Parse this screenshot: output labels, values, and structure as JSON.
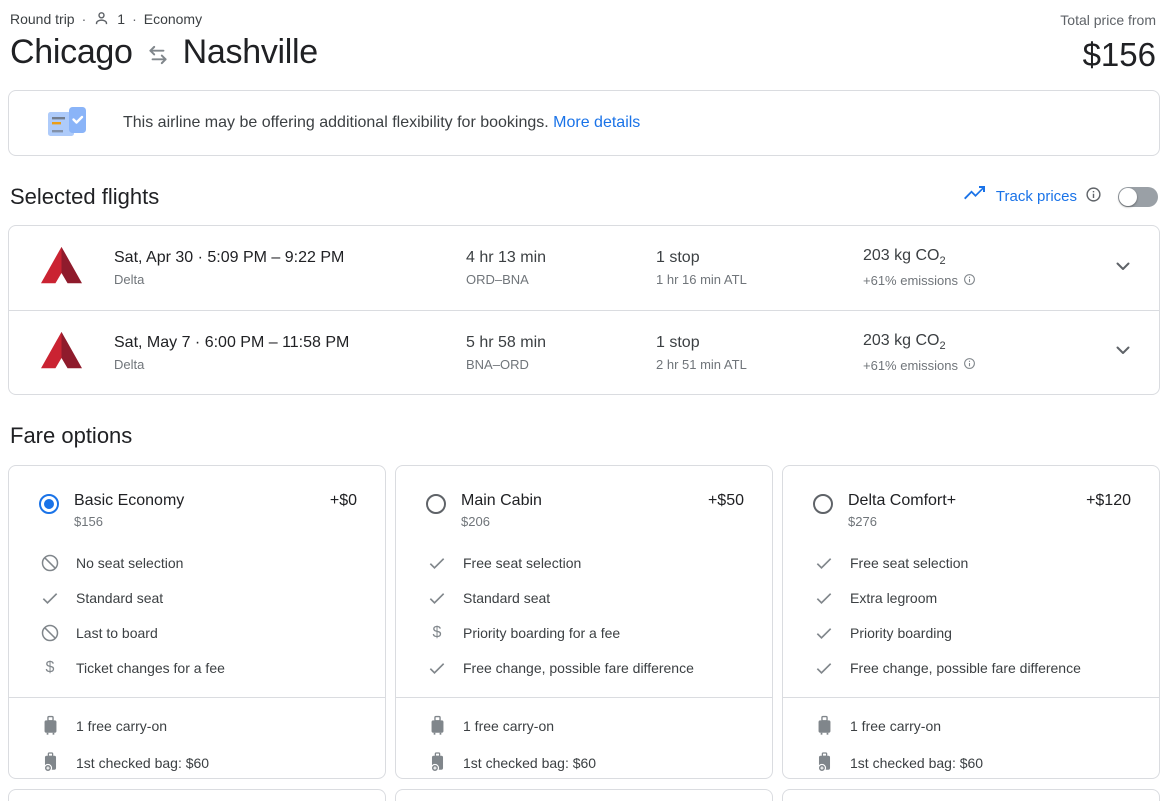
{
  "colors": {
    "accent_blue": "#1a73e8",
    "border_gray": "#dadce0",
    "text_dark": "#202124",
    "text_gray": "#5f6368",
    "delta_red_light": "#ca2332",
    "delta_red_dark": "#8f1b2c"
  },
  "header": {
    "trip_type": "Round trip",
    "separator": "·",
    "passengers": "1",
    "cabin": "Economy",
    "origin": "Chicago",
    "destination": "Nashville",
    "total_price_label": "Total price from",
    "total_price": "$156"
  },
  "banner": {
    "message": "This airline may be offering additional flexibility for bookings.",
    "link_label": "More details"
  },
  "selected_flights": {
    "title": "Selected flights",
    "track_prices_label": "Track prices",
    "toggle_state": "off",
    "flights": [
      {
        "date_times": "Sat, Apr 30  ·  5:09 PM – 9:22 PM",
        "airline": "Delta",
        "duration": "4 hr 13 min",
        "route": "ORD–BNA",
        "stops": "1 stop",
        "layover": "1 hr 16 min ATL",
        "emissions": "203 kg CO",
        "emissions_sub": "2",
        "emissions_delta": "+61% emissions"
      },
      {
        "date_times": "Sat, May 7  ·  6:00 PM – 11:58 PM",
        "airline": "Delta",
        "duration": "5 hr 58 min",
        "route": "BNA–ORD",
        "stops": "1 stop",
        "layover": "2 hr 51 min ATL",
        "emissions": "203 kg CO",
        "emissions_sub": "2",
        "emissions_delta": "+61% emissions"
      }
    ]
  },
  "fare_options": {
    "title": "Fare options",
    "cards": [
      {
        "name": "Basic Economy",
        "base_price": "$156",
        "price_delta": "+$0",
        "selected": true,
        "features": [
          {
            "icon": "slash",
            "label": "No seat selection"
          },
          {
            "icon": "check",
            "label": "Standard seat"
          },
          {
            "icon": "slash",
            "label": "Last to board"
          },
          {
            "icon": "dollar",
            "label": "Ticket changes for a fee"
          }
        ],
        "baggage": [
          {
            "icon": "carryon",
            "label": "1 free carry-on"
          },
          {
            "icon": "checkedbag",
            "label": "1st checked bag: $60"
          }
        ]
      },
      {
        "name": "Main Cabin",
        "base_price": "$206",
        "price_delta": "+$50",
        "selected": false,
        "features": [
          {
            "icon": "check",
            "label": "Free seat selection"
          },
          {
            "icon": "check",
            "label": "Standard seat"
          },
          {
            "icon": "dollar",
            "label": "Priority boarding for a fee"
          },
          {
            "icon": "check",
            "label": "Free change, possible fare difference"
          }
        ],
        "baggage": [
          {
            "icon": "carryon",
            "label": "1 free carry-on"
          },
          {
            "icon": "checkedbag",
            "label": "1st checked bag: $60"
          }
        ]
      },
      {
        "name": "Delta Comfort+",
        "base_price": "$276",
        "price_delta": "+$120",
        "selected": false,
        "features": [
          {
            "icon": "check",
            "label": "Free seat selection"
          },
          {
            "icon": "check",
            "label": "Extra legroom"
          },
          {
            "icon": "check",
            "label": "Priority boarding"
          },
          {
            "icon": "check",
            "label": "Free change, possible fare difference"
          }
        ],
        "baggage": [
          {
            "icon": "carryon",
            "label": "1 free carry-on"
          },
          {
            "icon": "checkedbag",
            "label": "1st checked bag: $60"
          }
        ]
      }
    ]
  }
}
